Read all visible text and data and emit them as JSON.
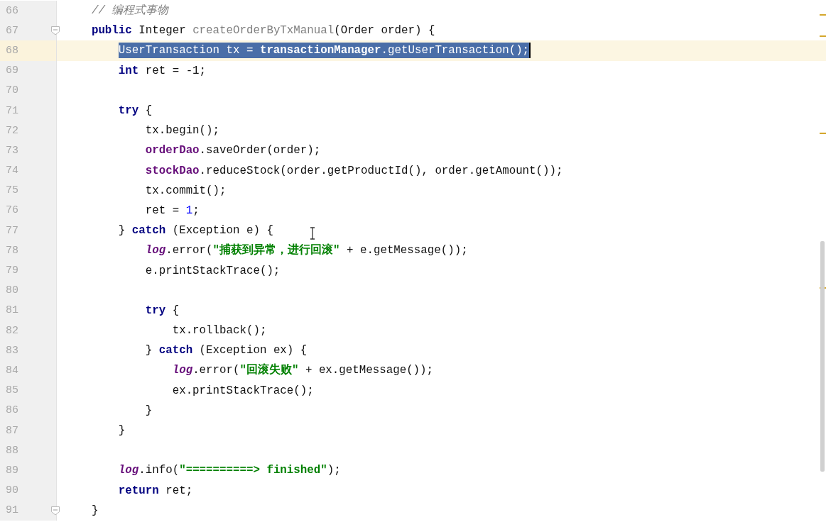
{
  "editor": {
    "lines": [
      {
        "number": "66",
        "selected": false,
        "fold": false,
        "tokens": [
          {
            "kind": "comment",
            "text": "// 编程式事物"
          }
        ]
      },
      {
        "number": "67",
        "selected": false,
        "fold": true,
        "tokens": [
          {
            "kind": "keyword",
            "text": "public"
          },
          {
            "kind": "plain",
            "text": " Integer "
          },
          {
            "kind": "unused",
            "text": "createOrderByTxManual"
          },
          {
            "kind": "plain",
            "text": "(Order order) {"
          }
        ],
        "children": [
          {
            "number": "68",
            "selected": true,
            "fold": false,
            "tokens": [
              {
                "kind": "plain",
                "text": "UserTransaction tx = "
              },
              {
                "kind": "field",
                "text": "transactionManager"
              },
              {
                "kind": "plain",
                "text": ".getUserTransaction();"
              }
            ]
          },
          {
            "number": "69",
            "selected": false,
            "fold": false,
            "tokens": [
              {
                "kind": "keyword",
                "text": "int"
              },
              {
                "kind": "plain",
                "text": " ret = -1;"
              }
            ]
          },
          {
            "number": "70",
            "selected": false,
            "fold": false
          },
          {
            "number": "71",
            "selected": false,
            "fold": false,
            "tokens": [
              {
                "kind": "keyword",
                "text": "try"
              },
              {
                "kind": "plain",
                "text": " {"
              }
            ],
            "children": [
              {
                "number": "72",
                "selected": false,
                "fold": false,
                "tokens": [
                  {
                    "kind": "plain",
                    "text": "tx.begin();"
                  }
                ]
              },
              {
                "number": "73",
                "selected": false,
                "fold": false,
                "tokens": [
                  {
                    "kind": "field",
                    "text": "orderDao"
                  },
                  {
                    "kind": "plain",
                    "text": ".saveOrder(order);"
                  }
                ]
              },
              {
                "number": "74",
                "selected": false,
                "fold": false,
                "tokens": [
                  {
                    "kind": "field",
                    "text": "stockDao"
                  },
                  {
                    "kind": "plain",
                    "text": ".reduceStock(order.getProductId(), order.getAmount());"
                  }
                ]
              },
              {
                "number": "75",
                "selected": false,
                "fold": false,
                "tokens": [
                  {
                    "kind": "plain",
                    "text": "tx.commit();"
                  }
                ]
              },
              {
                "number": "76",
                "selected": false,
                "fold": false,
                "tokens": [
                  {
                    "kind": "plain",
                    "text": "ret = "
                  },
                  {
                    "kind": "number",
                    "text": "1"
                  },
                  {
                    "kind": "plain",
                    "text": ";"
                  }
                ]
              }
            ]
          },
          {
            "number": "77",
            "selected": false,
            "fold": false,
            "tokens": [
              {
                "kind": "plain",
                "text": "} "
              },
              {
                "kind": "keyword",
                "text": "catch"
              },
              {
                "kind": "plain",
                "text": " (Exception e) {"
              }
            ],
            "children": [
              {
                "number": "78",
                "selected": false,
                "fold": false,
                "tokens": [
                  {
                    "kind": "static",
                    "text": "log"
                  },
                  {
                    "kind": "plain",
                    "text": ".error("
                  },
                  {
                    "kind": "string",
                    "text": "\"捕获到异常，进行回滚\""
                  },
                  {
                    "kind": "plain",
                    "text": " + e.getMessage());"
                  }
                ]
              },
              {
                "number": "79",
                "selected": false,
                "fold": false,
                "tokens": [
                  {
                    "kind": "plain",
                    "text": "e.printStackTrace();"
                  }
                ]
              },
              {
                "number": "80",
                "selected": false,
                "fold": false
              },
              {
                "number": "81",
                "selected": false,
                "fold": false,
                "tokens": [
                  {
                    "kind": "keyword",
                    "text": "try"
                  },
                  {
                    "kind": "plain",
                    "text": " {"
                  }
                ],
                "children": [
                  {
                    "number": "82",
                    "selected": false,
                    "fold": false,
                    "tokens": [
                      {
                        "kind": "plain",
                        "text": "tx.rollback();"
                      }
                    ]
                  }
                ]
              },
              {
                "number": "83",
                "selected": false,
                "fold": false,
                "tokens": [
                  {
                    "kind": "plain",
                    "text": "} "
                  },
                  {
                    "kind": "keyword",
                    "text": "catch"
                  },
                  {
                    "kind": "plain",
                    "text": " (Exception ex) {"
                  }
                ],
                "children": [
                  {
                    "number": "84",
                    "selected": false,
                    "fold": false,
                    "tokens": [
                      {
                        "kind": "static",
                        "text": "log"
                      },
                      {
                        "kind": "plain",
                        "text": ".error("
                      },
                      {
                        "kind": "string",
                        "text": "\"回滚失败\""
                      },
                      {
                        "kind": "plain",
                        "text": " + ex.getMessage());"
                      }
                    ]
                  },
                  {
                    "number": "85",
                    "selected": false,
                    "fold": false,
                    "tokens": [
                      {
                        "kind": "plain",
                        "text": "ex.printStackTrace();"
                      }
                    ]
                  }
                ]
              },
              {
                "number": "86",
                "selected": false,
                "fold": false,
                "tokens": [
                  {
                    "kind": "plain",
                    "text": "}"
                  }
                ]
              }
            ]
          },
          {
            "number": "87",
            "selected": false,
            "fold": false,
            "tokens": [
              {
                "kind": "plain",
                "text": "}"
              }
            ]
          },
          {
            "number": "88",
            "selected": false,
            "fold": false
          },
          {
            "number": "89",
            "selected": false,
            "fold": false,
            "tokens": [
              {
                "kind": "static",
                "text": "log"
              },
              {
                "kind": "plain",
                "text": ".info("
              },
              {
                "kind": "string",
                "text": "\"==========> finished\""
              },
              {
                "kind": "plain",
                "text": ");"
              }
            ]
          },
          {
            "number": "90",
            "selected": false,
            "fold": false,
            "tokens": [
              {
                "kind": "keyword",
                "text": "return"
              },
              {
                "kind": "plain",
                "text": " ret;"
              }
            ]
          }
        ]
      },
      {
        "number": "91",
        "selected": false,
        "fold": true,
        "tokens": [
          {
            "kind": "plain",
            "text": "}"
          }
        ]
      }
    ]
  }
}
